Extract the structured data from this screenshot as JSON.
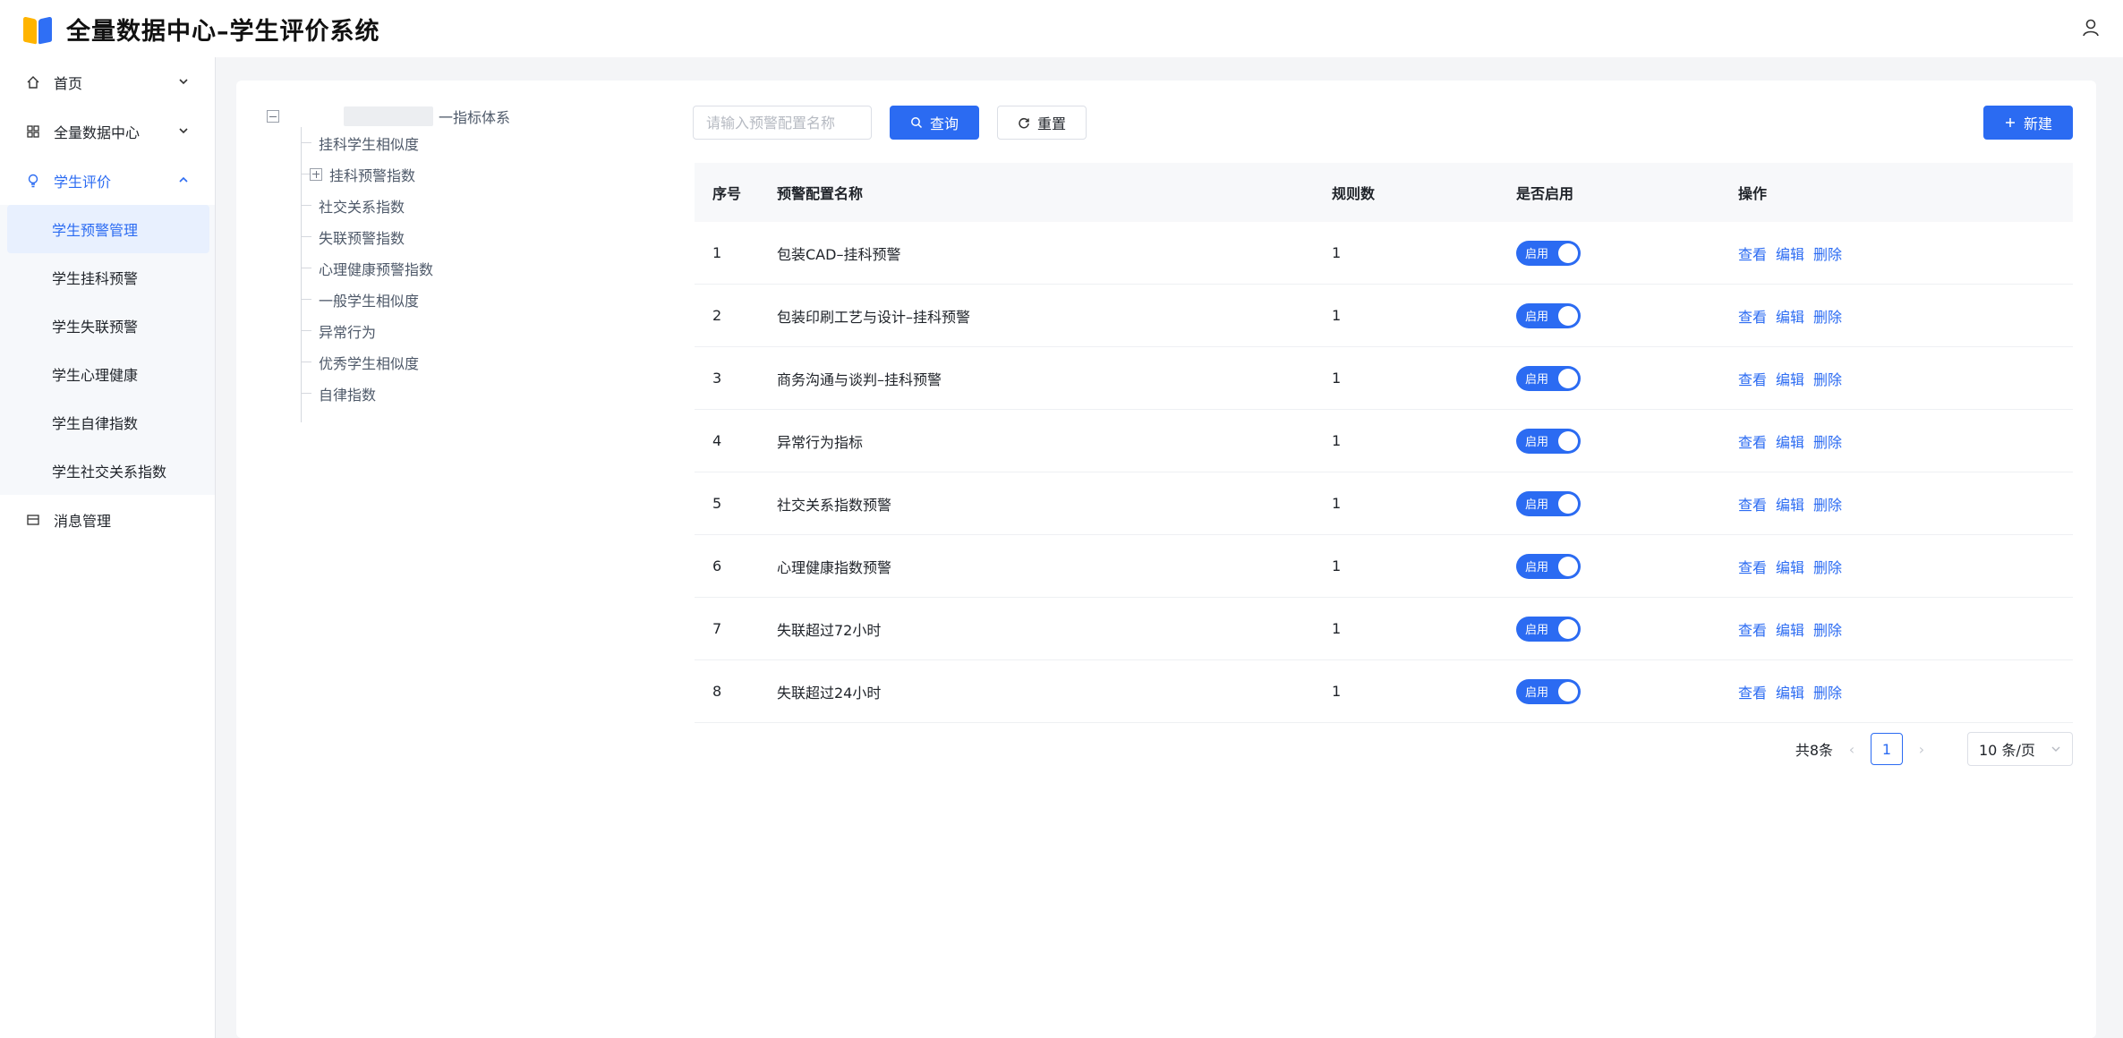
{
  "header": {
    "title": "全量数据中心–学生评价系统"
  },
  "sidebar": {
    "items": [
      {
        "label": "首页",
        "icon": "home-icon"
      },
      {
        "label": "全量数据中心",
        "icon": "grid-icon"
      },
      {
        "label": "学生评价",
        "icon": "bulb-icon"
      },
      {
        "label": "消息管理",
        "icon": "message-icon"
      }
    ],
    "submenu": [
      "学生预警管理",
      "学生挂科预警",
      "学生失联预警",
      "学生心理健康",
      "学生自律指数",
      "学生社交关系指数"
    ]
  },
  "tree": {
    "root": "一指标体系",
    "children": [
      "挂科学生相似度",
      "挂科预警指数",
      "社交关系指数",
      "失联预警指数",
      "心理健康预警指数",
      "一般学生相似度",
      "异常行为",
      "优秀学生相似度",
      "自律指数"
    ]
  },
  "toolbar": {
    "search_placeholder": "请输入预警配置名称",
    "search_label": "查询",
    "reset_label": "重置",
    "new_label": "新建"
  },
  "table": {
    "columns": [
      "序号",
      "预警配置名称",
      "规则数",
      "是否启用",
      "操作"
    ],
    "switch_label": "启用",
    "actions": [
      "查看",
      "编辑",
      "删除"
    ],
    "rows": [
      {
        "index": "1",
        "name": "包装CAD–挂科预警",
        "rules": "1",
        "enabled": true
      },
      {
        "index": "2",
        "name": "包装印刷工艺与设计–挂科预警",
        "rules": "1",
        "enabled": true
      },
      {
        "index": "3",
        "name": "商务沟通与谈判–挂科预警",
        "rules": "1",
        "enabled": true
      },
      {
        "index": "4",
        "name": "异常行为指标",
        "rules": "1",
        "enabled": true
      },
      {
        "index": "5",
        "name": "社交关系指数预警",
        "rules": "1",
        "enabled": true
      },
      {
        "index": "6",
        "name": "心理健康指数预警",
        "rules": "1",
        "enabled": true
      },
      {
        "index": "7",
        "name": "失联超过72小时",
        "rules": "1",
        "enabled": true
      },
      {
        "index": "8",
        "name": "失联超过24小时",
        "rules": "1",
        "enabled": true
      }
    ]
  },
  "pagination": {
    "total": "共8条",
    "current": "1",
    "page_size": "10 条/页"
  }
}
